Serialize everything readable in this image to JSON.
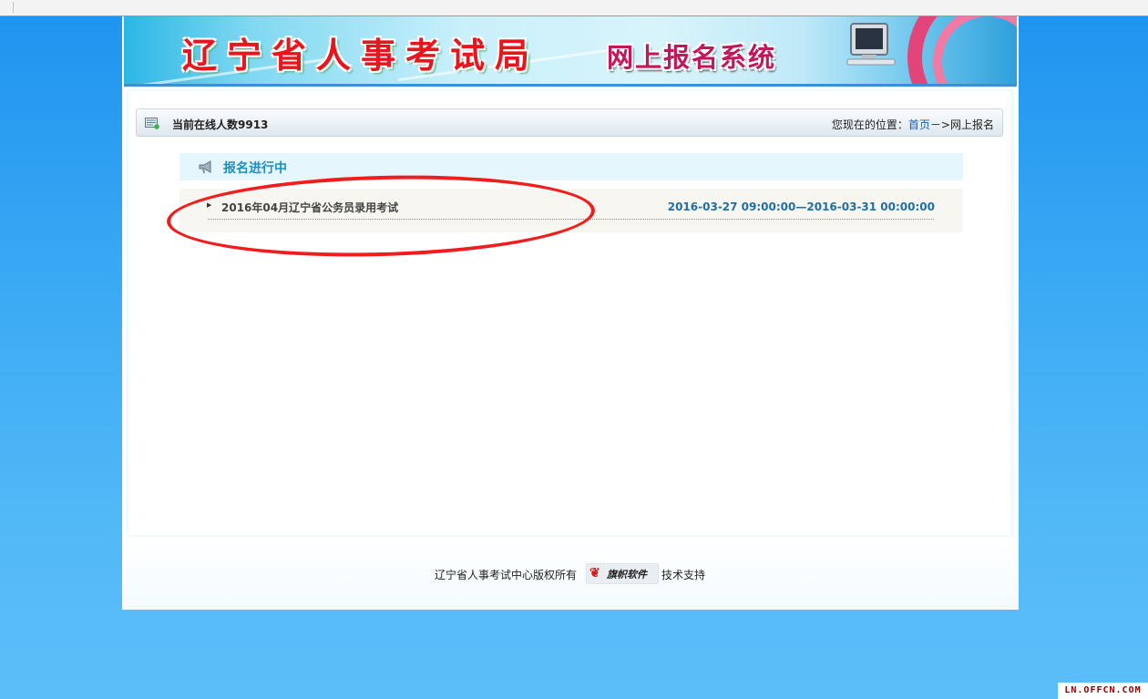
{
  "banner": {
    "title": "辽宁省人事考试局",
    "subtitle": "网上报名系统"
  },
  "status": {
    "online_count": "当前在线人数9913",
    "location_prefix": "您现在的位置：",
    "location_home": "首页",
    "location_separator": "－>",
    "location_current": "网上报名"
  },
  "section": {
    "title": "报名进行中"
  },
  "exams": [
    {
      "name": "2016年04月辽宁省公务员录用考试",
      "period": "2016-03-27 09:00:00—2016-03-31 00:00:00"
    }
  ],
  "footer": {
    "copyright": "辽宁省人事考试中心版权所有",
    "vendor_logo_text": "旗帜软件",
    "support": "技术支持"
  },
  "watermark": "LN.OFFCN.COM",
  "colors": {
    "background": "#3aa9f4",
    "accent": "#1f8fc0",
    "link": "#1a5ea8",
    "banner_title": "#e8151d",
    "highlight_circle": "#f11d1d"
  }
}
